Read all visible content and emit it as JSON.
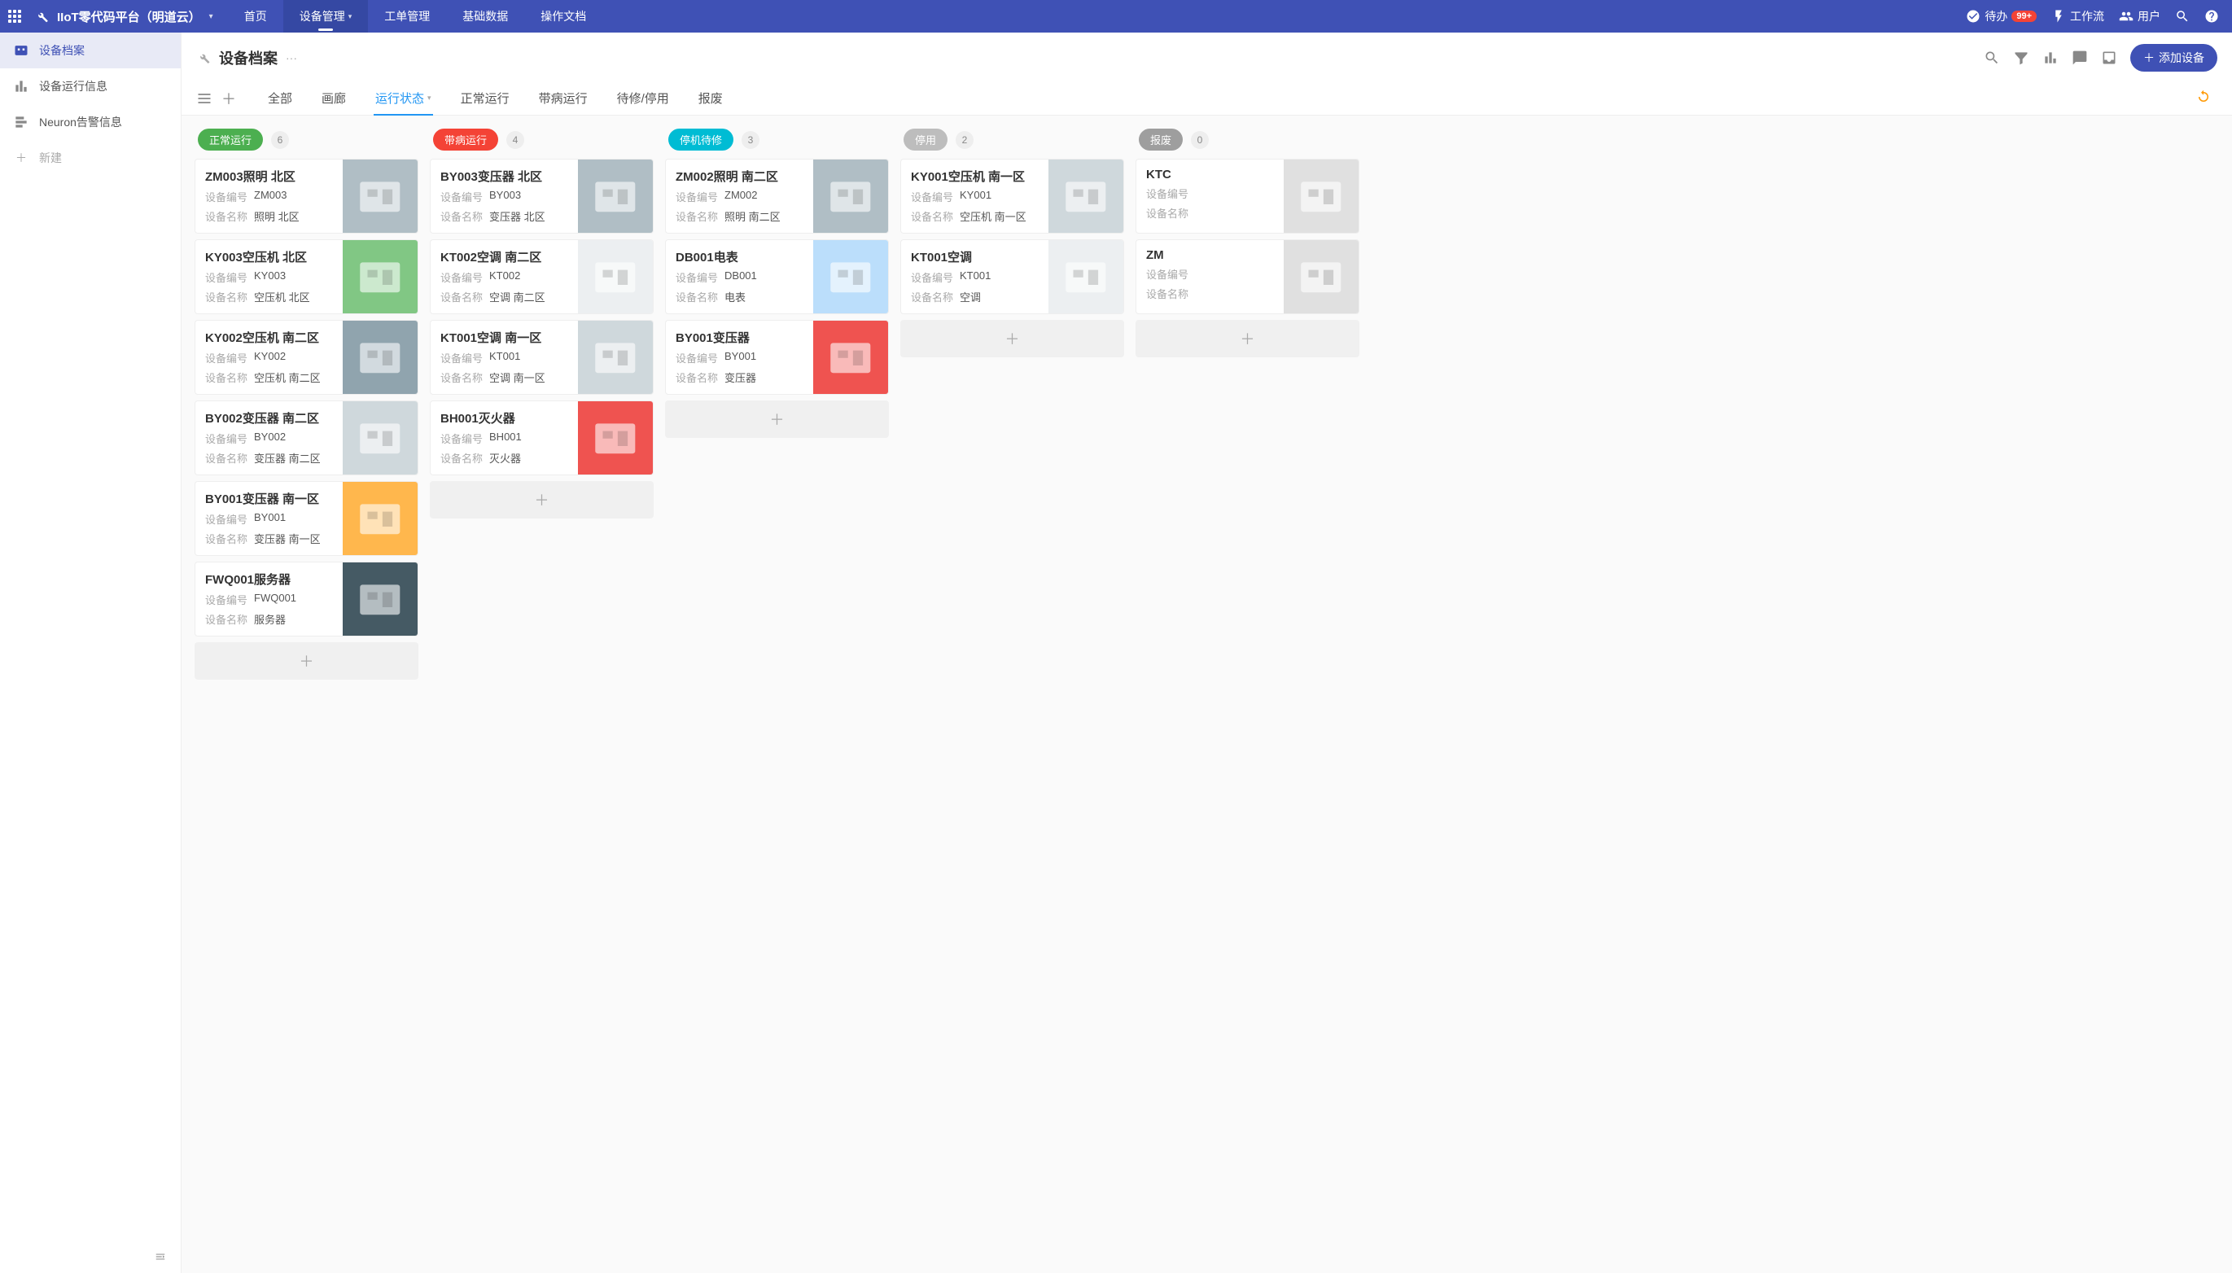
{
  "app": {
    "title": "IIoT零代码平台（明道云）"
  },
  "topnav": [
    {
      "label": "首页"
    },
    {
      "label": "设备管理",
      "active": true,
      "dropdown": true
    },
    {
      "label": "工单管理"
    },
    {
      "label": "基础数据"
    },
    {
      "label": "操作文档"
    }
  ],
  "topbar_right": {
    "todo_label": "待办",
    "todo_badge": "99+",
    "workflow_label": "工作流",
    "user_label": "用户"
  },
  "sidebar": {
    "items": [
      {
        "label": "设备档案",
        "active": true
      },
      {
        "label": "设备运行信息"
      },
      {
        "label": "Neuron告警信息"
      }
    ],
    "new_label": "新建"
  },
  "page": {
    "title": "设备档案",
    "add_button": "添加设备"
  },
  "tabs": [
    {
      "label": "全部"
    },
    {
      "label": "画廊"
    },
    {
      "label": "运行状态",
      "active": true,
      "dropdown": true
    },
    {
      "label": "正常运行"
    },
    {
      "label": "带病运行"
    },
    {
      "label": "待修/停用"
    },
    {
      "label": "报废"
    }
  ],
  "field_labels": {
    "code": "设备编号",
    "name": "设备名称"
  },
  "columns": [
    {
      "title": "正常运行",
      "color": "#4caf50",
      "count": 6,
      "cards": [
        {
          "title": "ZM003照明 北区",
          "code": "ZM003",
          "name": "照明 北区",
          "thumb": "#b0bec5"
        },
        {
          "title": "KY003空压机 北区",
          "code": "KY003",
          "name": "空压机 北区",
          "thumb": "#81c784"
        },
        {
          "title": "KY002空压机 南二区",
          "code": "KY002",
          "name": "空压机 南二区",
          "thumb": "#90a4ae"
        },
        {
          "title": "BY002变压器 南二区",
          "code": "BY002",
          "name": "变压器 南二区",
          "thumb": "#cfd8dc"
        },
        {
          "title": "BY001变压器 南一区",
          "code": "BY001",
          "name": "变压器 南一区",
          "thumb": "#ffb74d"
        },
        {
          "title": "FWQ001服务器",
          "code": "FWQ001",
          "name": "服务器",
          "thumb": "#455a64"
        }
      ]
    },
    {
      "title": "带病运行",
      "color": "#f44336",
      "count": 4,
      "cards": [
        {
          "title": "BY003变压器 北区",
          "code": "BY003",
          "name": "变压器 北区",
          "thumb": "#b0bec5"
        },
        {
          "title": "KT002空调 南二区",
          "code": "KT002",
          "name": "空调 南二区",
          "thumb": "#eceff1"
        },
        {
          "title": "KT001空调 南一区",
          "code": "KT001",
          "name": "空调 南一区",
          "thumb": "#cfd8dc"
        },
        {
          "title": "BH001灭火器",
          "code": "BH001",
          "name": "灭火器",
          "thumb": "#ef5350"
        }
      ]
    },
    {
      "title": "停机待修",
      "color": "#00bcd4",
      "count": 3,
      "cards": [
        {
          "title": "ZM002照明 南二区",
          "code": "ZM002",
          "name": "照明 南二区",
          "thumb": "#b0bec5"
        },
        {
          "title": "DB001电表",
          "code": "DB001",
          "name": "电表",
          "thumb": "#bbdefb"
        },
        {
          "title": "BY001变压器",
          "code": "BY001",
          "name": "变压器",
          "thumb": "#ef5350"
        }
      ]
    },
    {
      "title": "停用",
      "color": "#bdbdbd",
      "count": 2,
      "cards": [
        {
          "title": "KY001空压机 南一区",
          "code": "KY001",
          "name": "空压机 南一区",
          "thumb": "#cfd8dc"
        },
        {
          "title": "KT001空调",
          "code": "KT001",
          "name": "空调",
          "thumb": "#eceff1"
        }
      ]
    },
    {
      "title": "报废",
      "color": "#9e9e9e",
      "count": 0,
      "cards": [
        {
          "title": "KTC",
          "code": "",
          "name": "",
          "thumb": "#e0e0e0"
        },
        {
          "title": "ZM",
          "code": "",
          "name": "",
          "thumb": "#e0e0e0"
        }
      ]
    }
  ]
}
